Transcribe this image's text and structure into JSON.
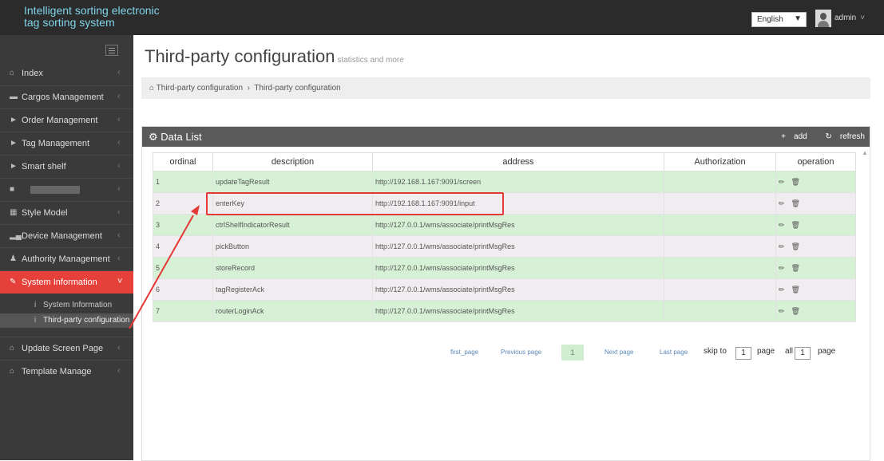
{
  "app": {
    "title": "Intelligent sorting electronic tag sorting system",
    "language": "English",
    "username": "admin"
  },
  "sidebar": {
    "items": [
      {
        "label": "Index",
        "icon": "home-icon"
      },
      {
        "label": "Cargos Management",
        "icon": "folder-icon"
      },
      {
        "label": "Order Management",
        "icon": "tag-icon"
      },
      {
        "label": "Tag Management",
        "icon": "tag-icon"
      },
      {
        "label": "Smart shelf",
        "icon": "tag-icon"
      },
      {
        "label": "",
        "icon": "redacted-icon"
      },
      {
        "label": "Style Model",
        "icon": "grid-icon"
      },
      {
        "label": "Device Management",
        "icon": "signal-icon"
      },
      {
        "label": "Authority Management",
        "icon": "user-icon"
      },
      {
        "label": "System Information",
        "icon": "edit-icon"
      }
    ],
    "subitems": [
      {
        "label": "System Information",
        "icon": "info-icon"
      },
      {
        "label": "Third-party configuration",
        "icon": "info-icon"
      }
    ],
    "items_after": [
      {
        "label": "Update Screen Page",
        "icon": "home-icon"
      },
      {
        "label": "Template Manage",
        "icon": "home-icon"
      }
    ]
  },
  "page": {
    "title": "Third-party configuration",
    "subtitle": "statistics and more",
    "breadcrumb": [
      "Third-party configuration",
      "Third-party configuration"
    ]
  },
  "panel": {
    "title": "Data List",
    "add_label": "add",
    "refresh_label": "refresh"
  },
  "table": {
    "columns": [
      "ordinal",
      "description",
      "address",
      "Authorization",
      "operation"
    ],
    "rows": [
      {
        "ordinal": "1",
        "description": "updateTagResult",
        "address": "http://192.168.1.167:9091/screen",
        "authorization": ""
      },
      {
        "ordinal": "2",
        "description": "enterKey",
        "address": "http://192.168.1.167:9091/input",
        "authorization": ""
      },
      {
        "ordinal": "3",
        "description": "ctrlShelfIndicatorResult",
        "address": "http://127.0.0.1/wms/associate/printMsgRes",
        "authorization": ""
      },
      {
        "ordinal": "4",
        "description": "pickButton",
        "address": "http://127.0.0.1/wms/associate/printMsgRes",
        "authorization": ""
      },
      {
        "ordinal": "5",
        "description": "storeRecord",
        "address": "http://127.0.0.1/wms/associate/printMsgRes",
        "authorization": ""
      },
      {
        "ordinal": "6",
        "description": "tagRegisterAck",
        "address": "http://127.0.0.1/wms/associate/printMsgRes",
        "authorization": ""
      },
      {
        "ordinal": "7",
        "description": "routerLoginAck",
        "address": "http://127.0.0.1/wms/associate/printMsgRes",
        "authorization": ""
      }
    ]
  },
  "pagination": {
    "first": "first_page",
    "previous": "Previous page",
    "current": "1",
    "next": "Next page",
    "last": "Last page",
    "skip_to": "skip to",
    "skip_value": "1",
    "page_word": "page",
    "all": "all",
    "total": "1",
    "page_word_2": "page"
  },
  "colors": {
    "accent": "#e5413a",
    "row_even": "#d6f1d6",
    "row_odd": "#f1ecef",
    "annotation": "#e53935"
  }
}
